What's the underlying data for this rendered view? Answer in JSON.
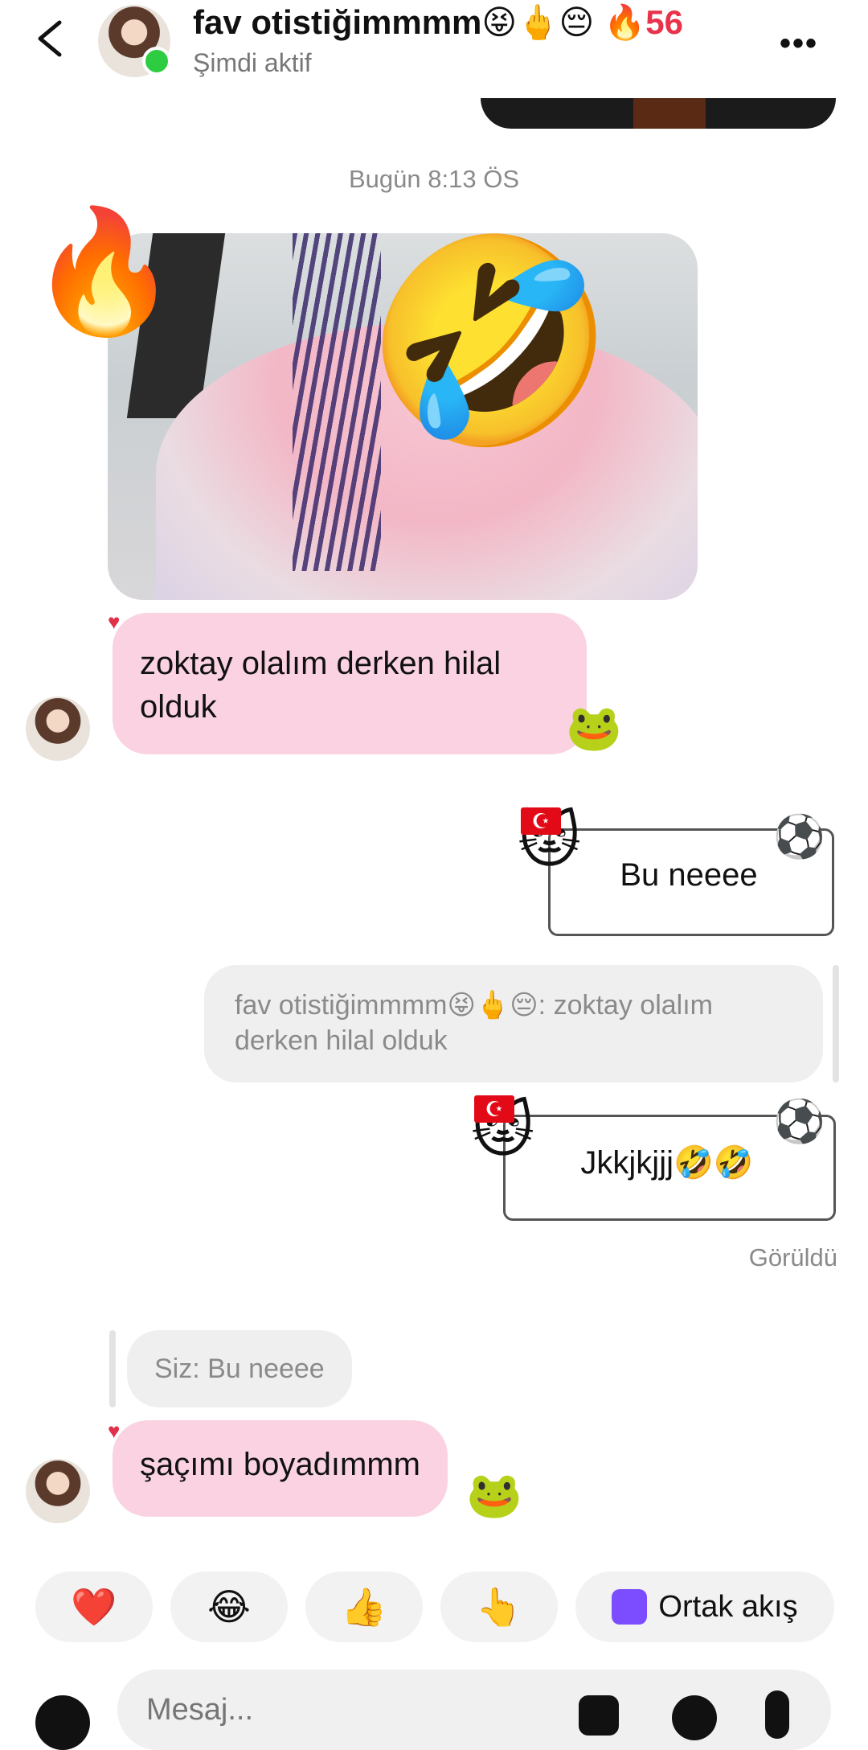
{
  "header": {
    "contact_name": "fav otistiğimmmm😝🖕😔",
    "streak_icon": "🔥",
    "streak_count": "56",
    "status": "Şimdi aktif",
    "more": "•••"
  },
  "timestamp": "Bugün 8:13 ÖS",
  "photo": {
    "emoji": "🤣",
    "sticker": "🔥"
  },
  "messages": {
    "m1": "zoktay olalım derken hilal olduk",
    "m1_reaction": "🐸",
    "sent1": "Bu neeee",
    "reply_quote": "fav otistiğimmmm😝🖕😔: zoktay olalım derken hilal olduk",
    "sent2": "Jkkjkjjj🤣🤣",
    "seen": "Görüldü",
    "reply2": "Siz: Bu neeee",
    "m2": "şaçımı boyadımmm",
    "m2_reaction": "🐸"
  },
  "sticker_parts": {
    "cat": "🐱",
    "flag": "☪",
    "ball": "⚽"
  },
  "quick_reactions": [
    "❤️",
    "😂",
    "👍",
    "👆"
  ],
  "ortak_akis": "Ortak akış",
  "composer": {
    "placeholder": "Mesaj..."
  },
  "colors": {
    "accent_pink": "#fad2e1",
    "online": "#2ecc40",
    "streak": "#e8334a"
  }
}
